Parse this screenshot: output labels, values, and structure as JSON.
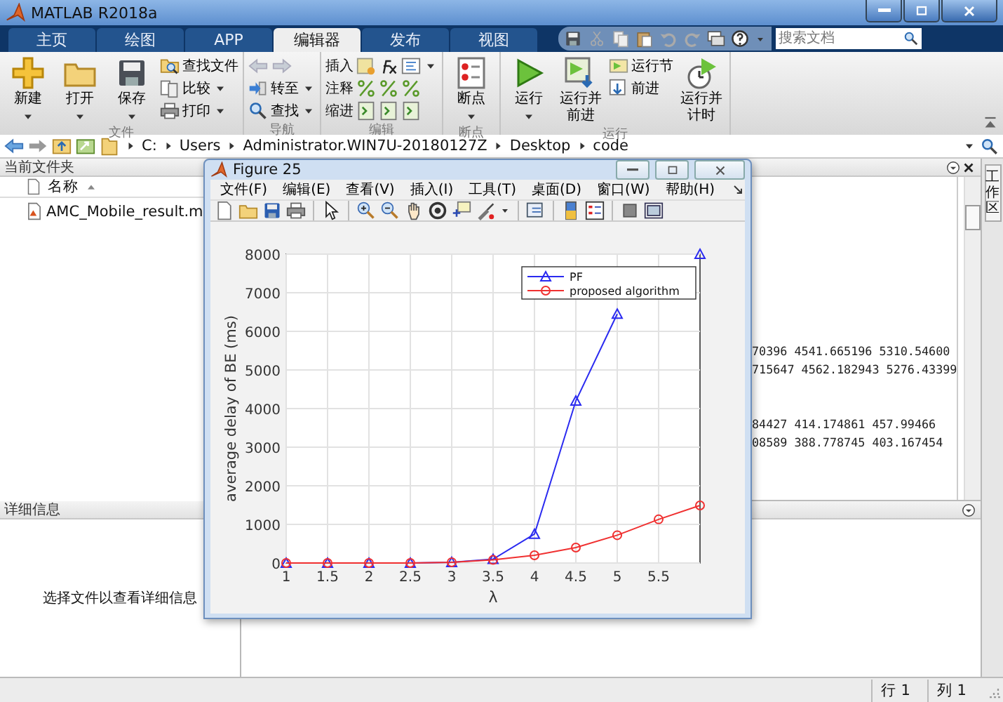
{
  "window": {
    "title": "MATLAB R2018a"
  },
  "tabs": [
    {
      "label": "主页",
      "selected": false
    },
    {
      "label": "绘图",
      "selected": false
    },
    {
      "label": "APP",
      "selected": false
    },
    {
      "label": "编辑器",
      "selected": true
    },
    {
      "label": "发布",
      "selected": false
    },
    {
      "label": "视图",
      "selected": false
    }
  ],
  "search": {
    "placeholder": "搜索文档"
  },
  "ribbon": {
    "groups": [
      {
        "title": "文件",
        "items": [
          {
            "kind": "large",
            "label": "新建",
            "menu": true
          },
          {
            "kind": "large",
            "label": "打开",
            "menu": true
          },
          {
            "kind": "large",
            "label": "保存",
            "menu": true
          },
          {
            "kind": "stack",
            "entries": [
              {
                "kind": "entry",
                "label": "查找文件",
                "menu": false
              },
              {
                "kind": "entry",
                "label": "比较",
                "menu": true
              },
              {
                "kind": "entry",
                "label": "打印",
                "menu": true
              }
            ]
          }
        ]
      },
      {
        "title": "导航",
        "items": [
          {
            "kind": "stack",
            "entries": [
              {
                "kind": "nav"
              },
              {
                "kind": "entry",
                "label": "转至",
                "menu": true
              },
              {
                "kind": "entry",
                "label": "查找",
                "menu": true
              }
            ]
          }
        ]
      },
      {
        "title": "编辑",
        "items": [
          {
            "kind": "stack",
            "entries": [
              {
                "kind": "tool-row",
                "label": "插入",
                "menu": true
              },
              {
                "kind": "tool-row",
                "label": "注释",
                "menu": false
              },
              {
                "kind": "tool-row",
                "label": "缩进",
                "menu": false
              }
            ]
          }
        ]
      },
      {
        "title": "断点",
        "items": [
          {
            "kind": "large",
            "label": "断点",
            "menu": true
          }
        ]
      },
      {
        "title": "运行",
        "items": [
          {
            "kind": "large",
            "label": "运行",
            "menu": true
          },
          {
            "kind": "large",
            "label": "运行并前进",
            "menu": false
          },
          {
            "kind": "stack",
            "entries": [
              {
                "kind": "entry",
                "label": "运行节",
                "menu": false
              },
              {
                "kind": "entry",
                "label": "前进",
                "menu": false
              }
            ]
          },
          {
            "kind": "large",
            "label": "运行并计时",
            "menu": false
          }
        ]
      }
    ]
  },
  "address_bar": {
    "path": [
      "C:",
      "Users",
      "Administrator.WIN7U-20180127Z",
      "Desktop",
      "code"
    ]
  },
  "current_folder": {
    "title": "当前文件夹",
    "column": "名称",
    "files": [
      "AMC_Mobile_result.m"
    ]
  },
  "details": {
    "title": "详细信息",
    "message": "选择文件以查看详细信息"
  },
  "editor": {
    "blocks": [
      [
        "70396 4541.665196 5310.54600",
        "715647 4562.182943 5276.43399"
      ],
      [
        "84427 414.174861 457.99466",
        "08589 388.778745 403.167454"
      ]
    ]
  },
  "workspace_tab": {
    "label": "工作区"
  },
  "status_bar": {
    "row": "行 1",
    "column": "列 1"
  },
  "figure": {
    "title": "Figure 25",
    "menu": [
      "文件(F)",
      "编辑(E)",
      "查看(V)",
      "插入(I)",
      "工具(T)",
      "桌面(D)",
      "窗口(W)",
      "帮助(H)"
    ],
    "chart_data": {
      "type": "line",
      "xlabel": "λ",
      "ylabel": "average delay of BE (ms)",
      "x": [
        1,
        1.5,
        2,
        2.5,
        3,
        3.5,
        4,
        4.5,
        5,
        5.5,
        6
      ],
      "series": [
        {
          "name": "PF",
          "color": "#2a2af0",
          "marker": "triangle",
          "values": [
            0,
            0,
            0,
            0,
            20,
            100,
            750,
            4200,
            6450,
            null,
            8000
          ]
        },
        {
          "name": "proposed algorithm",
          "color": "#f03030",
          "marker": "circle",
          "values": [
            0,
            0,
            0,
            0,
            20,
            80,
            200,
            400,
            720,
            1130,
            1490
          ]
        }
      ],
      "grid": true,
      "legend": true,
      "xlim": [
        1,
        6
      ],
      "ylim": [
        0,
        8000
      ],
      "xticks": [
        1,
        1.5,
        2,
        2.5,
        3,
        3.5,
        4,
        4.5,
        5,
        5.5
      ],
      "yticks": [
        0,
        1000,
        2000,
        3000,
        4000,
        5000,
        6000,
        7000,
        8000
      ]
    }
  }
}
